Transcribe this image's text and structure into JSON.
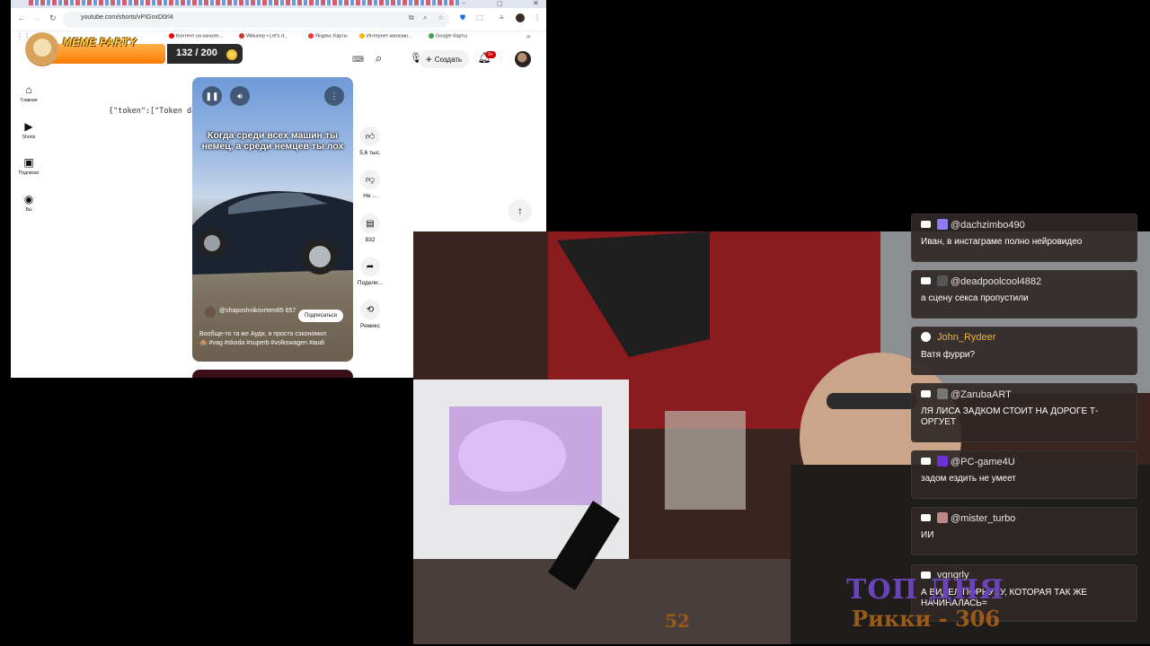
{
  "browser": {
    "url": "youtube.com/shorts/vPIGnxD0rl4",
    "bookmarks": [
      {
        "label": "Контент на канале...",
        "color": "#e00"
      },
      {
        "label": "Wikiamp • Let's d...",
        "color": "#c33"
      },
      {
        "label": "Яндекс Карты",
        "color": "#e33"
      },
      {
        "label": "Интернет-магазин...",
        "color": "#f7b500"
      },
      {
        "label": "Google Карты",
        "color": "#34a853"
      }
    ]
  },
  "youtube": {
    "create_label": "Создать",
    "notifications_badge": "9+",
    "nav": [
      {
        "label": "Главная",
        "icon": "home-icon"
      },
      {
        "label": "Shorts",
        "icon": "shorts-icon"
      },
      {
        "label": "Подписки",
        "icon": "subscriptions-icon"
      },
      {
        "label": "Вы",
        "icon": "you-icon"
      }
    ],
    "error_text": "{\"token\":[\"Token does not belong to any user\"]}",
    "short": {
      "caption": "Когда среди всех машин ты немец, а среди немцев ты лох",
      "channel": "@shaposhnikovrtem85 657",
      "subscribe_label": "Подписаться",
      "description": "Вообще-то та же Ауди, я просто сэкономил",
      "hashtags": "🙈 #vag #skoda #superb #volkswagen #audi"
    },
    "actions": [
      {
        "label": "5,6 тыс.",
        "icon": "like-icon"
      },
      {
        "label": "Не ...",
        "icon": "dislike-icon"
      },
      {
        "label": "832",
        "icon": "comment-icon"
      },
      {
        "label": "Подели...",
        "icon": "share-icon"
      },
      {
        "label": "Ремикс",
        "icon": "remix-icon"
      }
    ]
  },
  "meme_party": {
    "title": "MEME PARTY",
    "progress": "132 / 200",
    "progress_value": 0.66
  },
  "chat": [
    {
      "user": "@dachzimbo490",
      "text": "Иван, в инстаграме полно нейровидео"
    },
    {
      "user": "@deadpoolcool4882",
      "text": "а сцену секса пропустили"
    },
    {
      "user": "John_Rydeer",
      "text": "Ватя фурри?"
    },
    {
      "user": "@ZarubaART",
      "text": "ЛЯ ЛИСА ЗАДКОМ СТОИТ НА ДОРОГЕ Т-ОРГУЕТ"
    },
    {
      "user": "@PC-game4U",
      "text": "задом ездить не умеет"
    },
    {
      "user": "@mister_turbo",
      "text": "ИИ"
    },
    {
      "user": "vgngrly",
      "text": "А ВИДЕЛ ПОРНУХУ, КОТОРАЯ ТАК ЖЕ НАЧИНАЛАСЬ="
    }
  ],
  "overlay": {
    "top_day": "ТОП ДНЯ",
    "top_name": "Рикки - 306",
    "left_number": "52"
  }
}
